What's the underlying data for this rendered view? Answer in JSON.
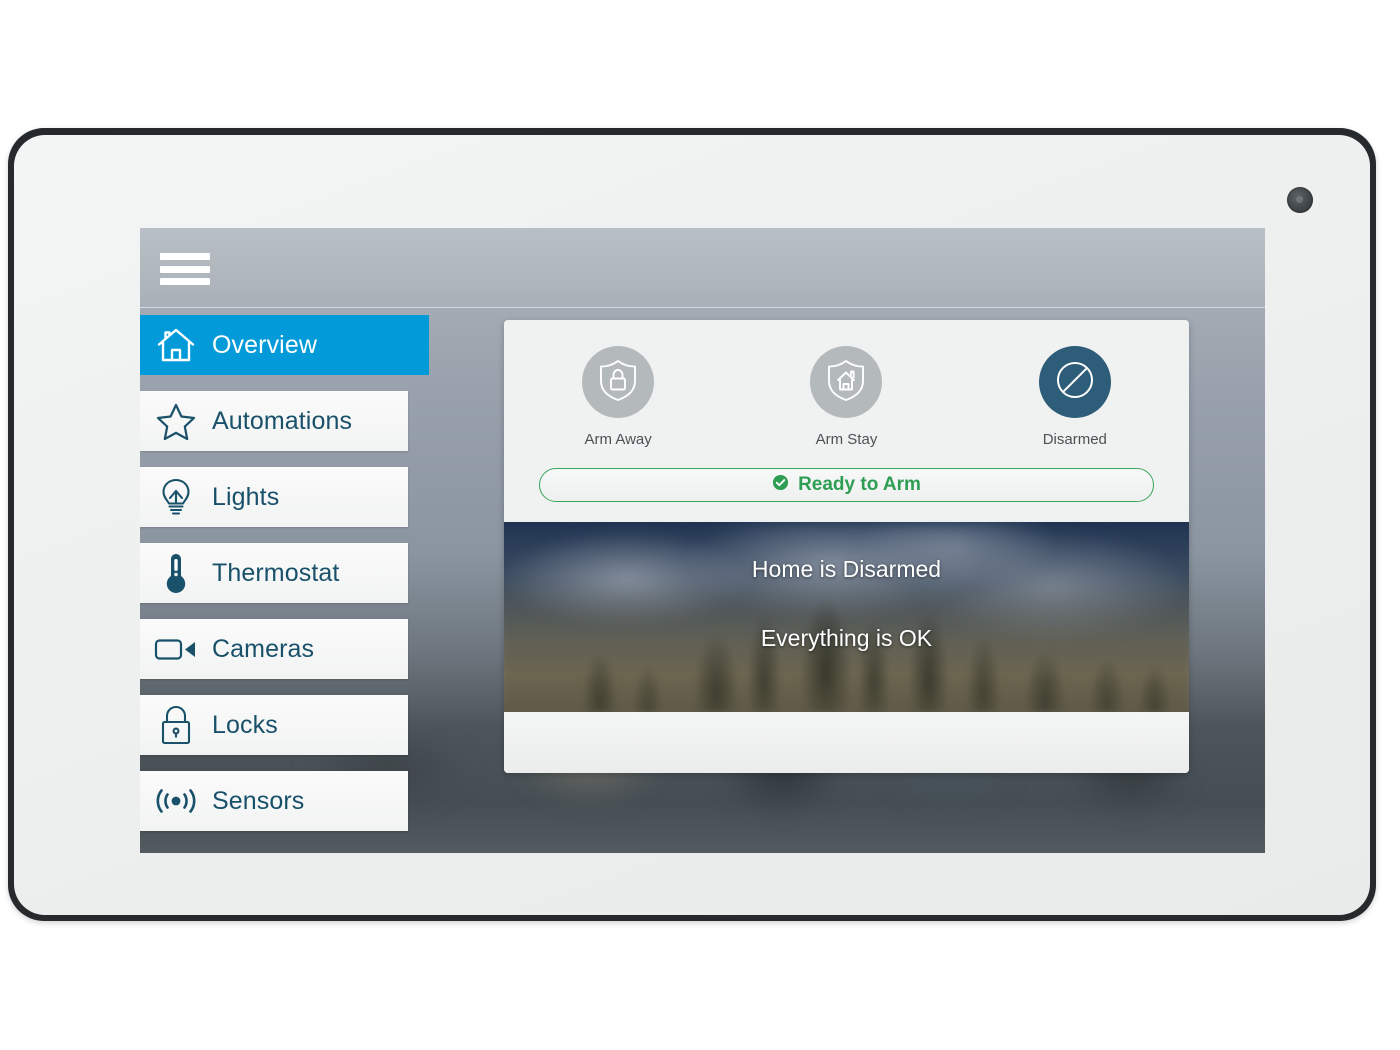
{
  "device": {
    "camera_icon": "camera-dot"
  },
  "topbar": {
    "menu_icon": "hamburger-menu-icon"
  },
  "sidebar": {
    "items": [
      {
        "label": "Overview",
        "icon": "home-icon",
        "active": true
      },
      {
        "label": "Automations",
        "icon": "star-icon",
        "active": false
      },
      {
        "label": "Lights",
        "icon": "lightbulb-icon",
        "active": false
      },
      {
        "label": "Thermostat",
        "icon": "thermometer-icon",
        "active": false
      },
      {
        "label": "Cameras",
        "icon": "video-camera-icon",
        "active": false
      },
      {
        "label": "Locks",
        "icon": "padlock-icon",
        "active": false
      },
      {
        "label": "Sensors",
        "icon": "motion-sensor-icon",
        "active": false
      }
    ]
  },
  "panel": {
    "arm_modes": [
      {
        "label": "Arm Away",
        "icon": "shield-lock-icon",
        "selected": false
      },
      {
        "label": "Arm Stay",
        "icon": "shield-home-icon",
        "selected": false
      },
      {
        "label": "Disarmed",
        "icon": "circle-slash-icon",
        "selected": true
      }
    ],
    "status_bar": {
      "label": "Ready to Arm",
      "icon": "check-circle-icon"
    },
    "hero": {
      "line1": "Home is Disarmed",
      "line2": "Everything is OK"
    }
  },
  "colors": {
    "accent_blue": "#039ada",
    "nav_text": "#19506a",
    "status_green": "#2e9e54",
    "selected_mode": "#2d5d78",
    "mode_disc": "#b4b9bc"
  }
}
